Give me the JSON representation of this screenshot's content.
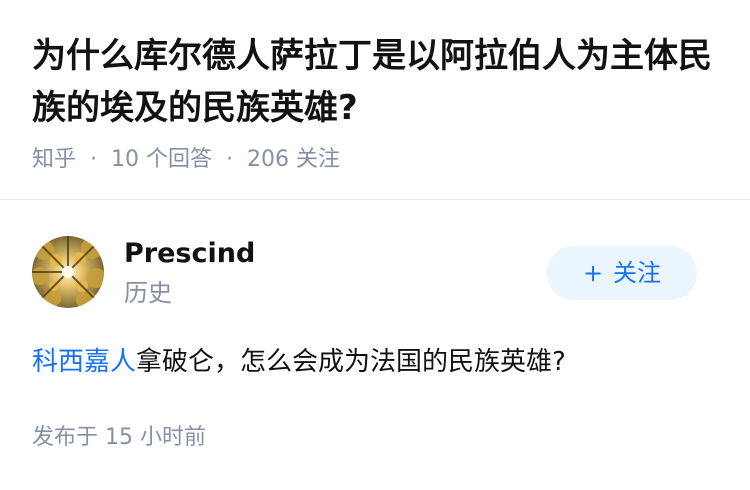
{
  "question": {
    "title": "为什么库尔德人萨拉丁是以阿拉伯人为主体民族的埃及的民族英雄?",
    "source": "知乎",
    "answers_count": "10",
    "answers_label": "个回答",
    "followers_count": "206",
    "followers_label": "关注"
  },
  "answer": {
    "author": {
      "name": "Prescind",
      "bio": "历史"
    },
    "follow_button": {
      "icon": "plus-icon",
      "label": "关注"
    },
    "body": {
      "link_text": "科西嘉人",
      "text": "拿破仑，怎么会成为法国的民族英雄?"
    },
    "published": {
      "label": "发布于",
      "time": "15 小时前"
    }
  },
  "colors": {
    "brand_blue": "#1772f6",
    "button_bg": "#ebf5ff",
    "meta_gray": "#8590a6",
    "text": "#121212"
  }
}
